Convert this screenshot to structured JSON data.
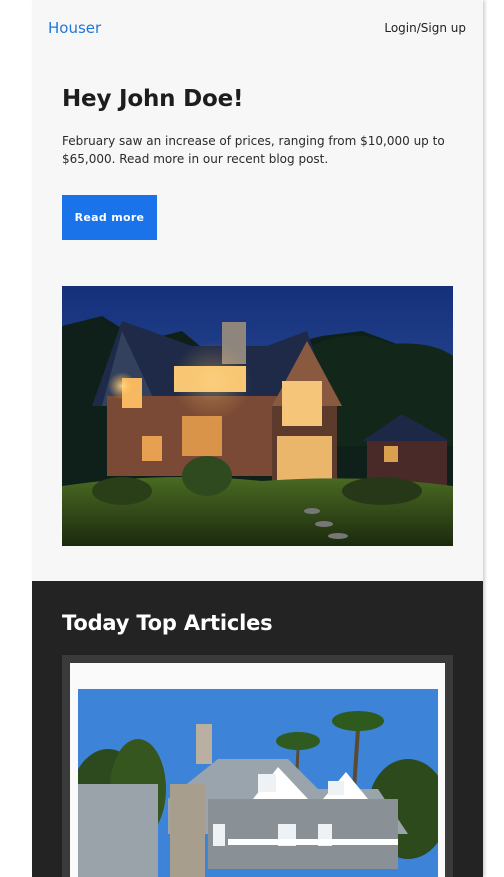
{
  "header": {
    "brand": "Houser",
    "login_label": "Login/Sign up"
  },
  "hero_section": {
    "greeting": "Hey John Doe!",
    "intro": "February saw an increase of prices, ranging from $10,000 up to $65,000. Read more in our recent blog post.",
    "cta_label": "Read more",
    "image": "house-at-night-photo"
  },
  "articles": {
    "title": "Today Top Articles",
    "items": [
      {
        "image": "house-with-palm-trees-photo"
      }
    ]
  },
  "colors": {
    "brand": "#1f78d7",
    "button": "#1a73e8",
    "dark_section": "#232323",
    "background": "#f7f7f7"
  }
}
